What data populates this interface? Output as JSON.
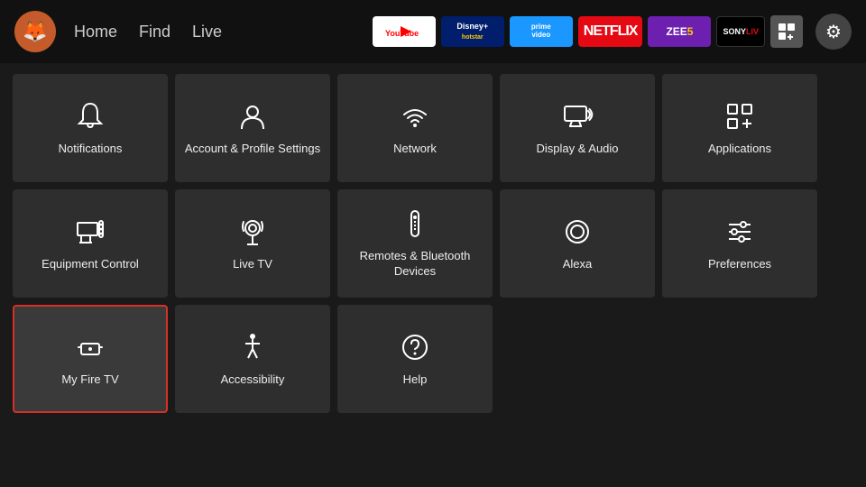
{
  "nav": {
    "logo_emoji": "🦊",
    "links": [
      "Home",
      "Find",
      "Live"
    ],
    "apps": [
      {
        "name": "YouTube",
        "class": "app-youtube",
        "label": "▶ YouTube"
      },
      {
        "name": "Disney+ Hotstar",
        "class": "app-disney",
        "label": "Disney+\nhotstar"
      },
      {
        "name": "Prime Video",
        "class": "app-prime",
        "label": "prime video"
      },
      {
        "name": "Netflix",
        "class": "app-netflix",
        "label": "NETFLIX"
      },
      {
        "name": "ZEE5",
        "class": "app-zee5",
        "label": "ZEE5"
      },
      {
        "name": "SonyLIV",
        "class": "app-sonyliv",
        "label": "SONY\nLIV"
      }
    ],
    "settings_icon": "⚙"
  },
  "grid": {
    "rows": [
      [
        {
          "id": "notifications",
          "label": "Notifications",
          "icon": "bell"
        },
        {
          "id": "account-profile",
          "label": "Account & Profile Settings",
          "icon": "person"
        },
        {
          "id": "network",
          "label": "Network",
          "icon": "wifi"
        },
        {
          "id": "display-audio",
          "label": "Display & Audio",
          "icon": "display"
        },
        {
          "id": "applications",
          "label": "Applications",
          "icon": "apps"
        }
      ],
      [
        {
          "id": "equipment-control",
          "label": "Equipment Control",
          "icon": "tv"
        },
        {
          "id": "live-tv",
          "label": "Live TV",
          "icon": "antenna"
        },
        {
          "id": "remotes-bluetooth",
          "label": "Remotes & Bluetooth Devices",
          "icon": "remote"
        },
        {
          "id": "alexa",
          "label": "Alexa",
          "icon": "alexa"
        },
        {
          "id": "preferences",
          "label": "Preferences",
          "icon": "sliders"
        }
      ],
      [
        {
          "id": "my-fire-tv",
          "label": "My Fire TV",
          "icon": "firetv",
          "selected": true
        },
        {
          "id": "accessibility",
          "label": "Accessibility",
          "icon": "accessibility"
        },
        {
          "id": "help",
          "label": "Help",
          "icon": "help"
        },
        null,
        null
      ]
    ]
  }
}
